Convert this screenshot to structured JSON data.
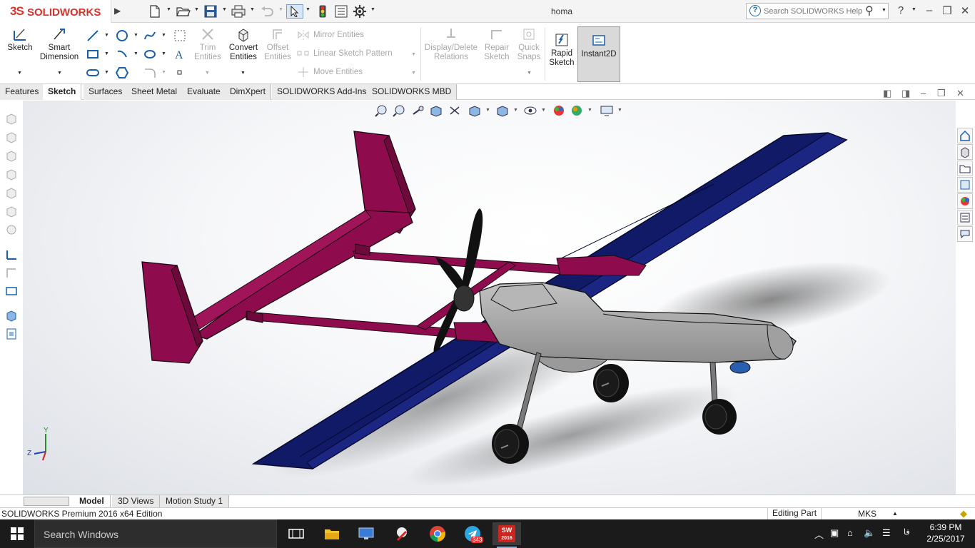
{
  "app": {
    "brand_ds": "3S",
    "brand_name": "SOLIDWORKS",
    "document_title": "homa",
    "help_search_placeholder": "Search SOLIDWORKS Help",
    "help_glyph": "?"
  },
  "quick_access": [
    {
      "icon": "new-document-icon"
    },
    {
      "icon": "open-folder-icon"
    },
    {
      "icon": "save-icon"
    },
    {
      "icon": "print-icon"
    },
    {
      "icon": "undo-icon"
    },
    {
      "icon": "select-arrow-icon"
    },
    {
      "icon": "rebuild-traffic-light-icon"
    },
    {
      "icon": "file-properties-icon"
    },
    {
      "icon": "options-gear-icon"
    }
  ],
  "ribbon": {
    "sketch": "Sketch",
    "smart_dimension_1": "Smart",
    "smart_dimension_2": "Dimension",
    "trim_1": "Trim",
    "trim_2": "Entities",
    "convert_1": "Convert",
    "convert_2": "Entities",
    "offset_1": "Offset",
    "offset_2": "Entities",
    "mirror": "Mirror Entities",
    "linear_pattern": "Linear Sketch Pattern",
    "move": "Move Entities",
    "display_delete_1": "Display/Delete",
    "display_delete_2": "Relations",
    "repair_1": "Repair",
    "repair_2": "Sketch",
    "quick_snaps_1": "Quick",
    "quick_snaps_2": "Snaps",
    "rapid_1": "Rapid",
    "rapid_2": "Sketch",
    "instant2d": "Instant2D"
  },
  "command_tabs": [
    "Features",
    "Sketch",
    "Surfaces",
    "Sheet Metal",
    "Evaluate",
    "DimXpert",
    "SOLIDWORKS Add-Ins",
    "SOLIDWORKS MBD"
  ],
  "active_command_tab": "Sketch",
  "bottom_tabs": [
    "Model",
    "3D Views",
    "Motion Study 1"
  ],
  "active_bottom_tab": "Model",
  "status": {
    "product": "SOLIDWORKS Premium 2016 x64 Edition",
    "mode": "Editing Part",
    "units": "MKS"
  },
  "triad": {
    "y": "Y",
    "z": "Z"
  },
  "taskbar": {
    "search_placeholder": "Search Windows",
    "telegram_badge": "343",
    "solidworks_label": "SW",
    "solidworks_year": "2016",
    "language": "ﻓﺎ",
    "time": "6:39 PM",
    "date": "2/25/2017"
  },
  "colors": {
    "tail": "#8e0c4d",
    "wing": "#101a66",
    "fuselage": "#a7a7a7",
    "propeller": "#111111",
    "brand_red": "#d0342c",
    "taskbar": "#1b1b1b"
  }
}
